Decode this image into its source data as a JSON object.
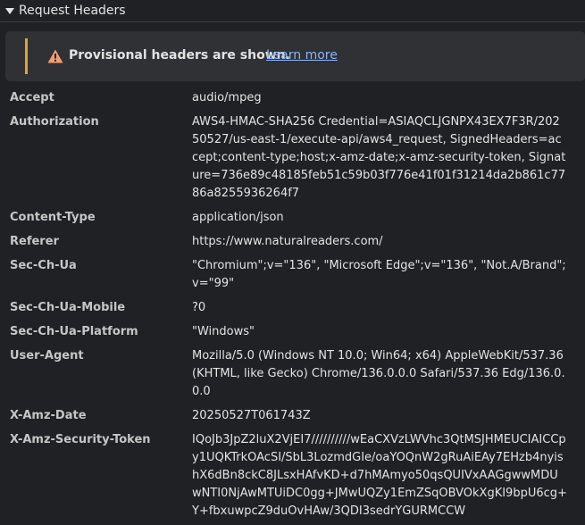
{
  "section": {
    "title": "Request Headers"
  },
  "warning": {
    "message": "Provisional headers are shown.",
    "link": "Learn more",
    "accent_color": "#e3a330",
    "icon": "warning-triangle-icon"
  },
  "headers": [
    {
      "name": "Accept",
      "value": "audio/mpeg"
    },
    {
      "name": "Authorization",
      "value": "AWS4-HMAC-SHA256 Credential=ASIAQCLJGNPX43EX7F3R/20250527/us-east-1/execute-api/aws4_request, SignedHeaders=accept;content-type;host;x-amz-date;x-amz-security-token, Signature=736e89c48185feb51c59b03f776e41f01f31214da2b861c7786a8255936264f7"
    },
    {
      "name": "Content-Type",
      "value": "application/json"
    },
    {
      "name": "Referer",
      "value": "https://www.naturalreaders.com/"
    },
    {
      "name": "Sec-Ch-Ua",
      "value": "\"Chromium\";v=\"136\", \"Microsoft Edge\";v=\"136\", \"Not.A/Brand\";v=\"99\""
    },
    {
      "name": "Sec-Ch-Ua-Mobile",
      "value": "?0"
    },
    {
      "name": "Sec-Ch-Ua-Platform",
      "value": "\"Windows\""
    },
    {
      "name": "User-Agent",
      "value": "Mozilla/5.0 (Windows NT 10.0; Win64; x64) AppleWebKit/537.36 (KHTML, like Gecko) Chrome/136.0.0.0 Safari/537.36 Edg/136.0.0.0"
    },
    {
      "name": "X-Amz-Date",
      "value": "20250527T061743Z"
    },
    {
      "name": "X-Amz-Security-Token",
      "value": "IQoJb3JpZ2luX2VjEI7//////////wEaCXVzLWVhc3QtMSJHMEUCIAICCpy1UQKTrkOAcSI/SbL3LozmdGIe/oaYOQnW2gRuAiEAy7EHzb4nyishX6dBn8ckC8JLsxHAfvKD+d7hMAmyo50qsQUIVxAAGgwwMDUwNTI0NjAwMTUiDC0gg+JMwUQZy1EmZSqOBVOkXgKI9bpU6cg+Y+fbxuwpcZ9duOvHAw/3QDI3sedrYGURMCCW"
    }
  ]
}
